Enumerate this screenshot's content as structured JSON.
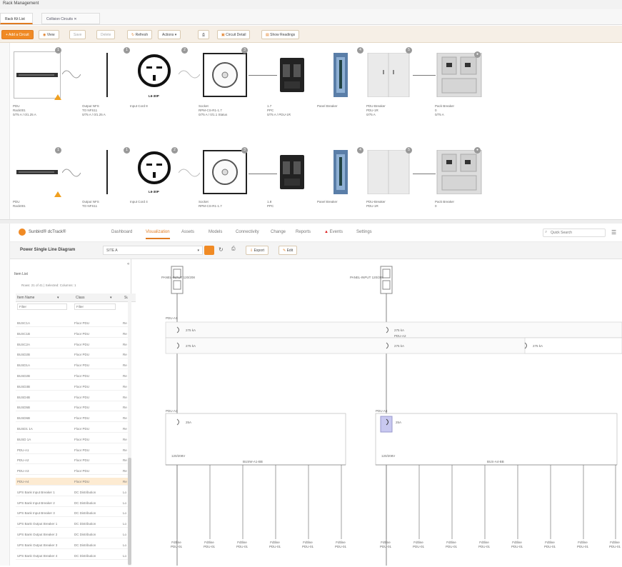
{
  "window": {
    "title": "Rack Management"
  },
  "tabs": [
    {
      "label": "Rack Kit List",
      "active": true
    },
    {
      "label": "Collision Circuits",
      "active": false
    }
  ],
  "toolbar": {
    "add_circuit": "Add a Circuit",
    "view": "View",
    "save": "Save",
    "delete": "Delete",
    "refresh": "Refresh",
    "actions": "Actions",
    "print": "",
    "circuit_detail": "Circuit Detail",
    "show_readings": "Show Readings"
  },
  "chain1": {
    "devices": [
      {
        "name": "PDU",
        "lines": [
          "PDU",
          "Rack001",
          "0/75 A / 0/1.25 A"
        ],
        "badge": "1"
      },
      {
        "name": "Output Cable",
        "lines": [
          "Output NFS",
          "TO NFS11",
          "0/75 A / 0/1.25 A"
        ],
        "badge": "1"
      },
      {
        "name": "Input Cord",
        "lines": [
          "Input Cord 8"
        ],
        "badge": "2",
        "plug": "L6-30P"
      },
      {
        "name": "Receptacle",
        "lines": [
          "Socket",
          "RPM-CS-R1-1.7",
          "0/75 A / 0/1.1 Status"
        ],
        "badge": "3"
      },
      {
        "name": "Breaker",
        "lines": [
          "1.7",
          "PPC",
          "0/75 A / PDU-1R"
        ],
        "badge": ""
      },
      {
        "name": "Panel",
        "lines": [
          "Panel Breaker"
        ],
        "badge": ""
      },
      {
        "name": "PDU-cabinet",
        "lines": [
          "PDU-Breaker",
          "PDU-1R",
          "0/75 A"
        ],
        "badge": "4"
      },
      {
        "name": "Switchgear",
        "lines": [
          "Pack Breaker",
          "0",
          "0/75 A"
        ],
        "badge": "5"
      }
    ]
  },
  "chain2": {
    "devices": [
      {
        "name": "PDU",
        "lines": [
          "PDU",
          "Rack001"
        ],
        "badge": "1"
      },
      {
        "name": "Output Cable",
        "lines": [
          "Output NFS",
          "TO NFS11"
        ],
        "badge": "1"
      },
      {
        "name": "Input Cord",
        "lines": [
          "Input Cord 4"
        ],
        "badge": "2",
        "plug": "L6-30P"
      },
      {
        "name": "Receptacle",
        "lines": [
          "Socket",
          "RPM-CS-R1-1.7"
        ],
        "badge": "3"
      },
      {
        "name": "Breaker",
        "lines": [
          "1.8",
          "PPC"
        ],
        "badge": ""
      },
      {
        "name": "Panel",
        "lines": [
          "Panel Breaker"
        ],
        "badge": ""
      },
      {
        "name": "PDU-cabinet",
        "lines": [
          "PDU-Breaker",
          "PDU-1R"
        ],
        "badge": "4"
      },
      {
        "name": "Switchgear",
        "lines": [
          "Pack Breaker",
          "0"
        ],
        "badge": "5"
      }
    ]
  },
  "app": {
    "brand": "Sunbird® dcTrack®",
    "nav": [
      "Dashboard",
      "Visualization",
      "Assets",
      "Models",
      "Connectivity",
      "Change",
      "Reports",
      "Events",
      "Settings"
    ],
    "active_nav": "Visualization",
    "search_placeholder": "Quick Search"
  },
  "subbar": {
    "title": "Power Single Line Diagram",
    "location": "SITE A",
    "export": "Export",
    "edit": "Edit"
  },
  "item_list": {
    "title": "Item List",
    "summary": "Rows: 21 of 41   |   Selected: Columns: 1",
    "col_name": "Item Name",
    "col_class": "Class",
    "col_sub": "Sub",
    "filter": "Filter",
    "rows": [
      {
        "name": "BUSC1A",
        "cls": "Floor PDU",
        "sub": "Re"
      },
      {
        "name": "BUSC1B",
        "cls": "Floor PDU",
        "sub": "Re"
      },
      {
        "name": "BUSC2A",
        "cls": "Floor PDU",
        "sub": "Re"
      },
      {
        "name": "BUSD2B",
        "cls": "Floor PDU",
        "sub": "Re"
      },
      {
        "name": "BUSD1A",
        "cls": "Floor PDU",
        "sub": "Re"
      },
      {
        "name": "BUSD2B",
        "cls": "Floor PDU",
        "sub": "Re"
      },
      {
        "name": "BUSD3B",
        "cls": "Floor PDU",
        "sub": "Re"
      },
      {
        "name": "BUSD4B",
        "cls": "Floor PDU",
        "sub": "Re"
      },
      {
        "name": "BUSD5B",
        "cls": "Floor PDU",
        "sub": "Re"
      },
      {
        "name": "BUSD6B",
        "cls": "Floor PDU",
        "sub": "Re"
      },
      {
        "name": "BUSD1 1A",
        "cls": "Floor PDU",
        "sub": "Re"
      },
      {
        "name": "BUSD 1A",
        "cls": "Floor PDU",
        "sub": "Re"
      },
      {
        "name": "PDU-A1",
        "cls": "Floor PDU",
        "sub": "Re"
      },
      {
        "name": "PDU-A2",
        "cls": "Floor PDU",
        "sub": "Re"
      },
      {
        "name": "PDU-A3",
        "cls": "Floor PDU",
        "sub": "Re"
      },
      {
        "name": "PDU-A4",
        "cls": "Floor PDU",
        "sub": "Re",
        "selected": true
      },
      {
        "name": "UPS Bank Input Breaker 1",
        "cls": "DC Distribution",
        "sub": "Lo"
      },
      {
        "name": "UPS Bank Input Breaker 2",
        "cls": "DC Distribution",
        "sub": "Lo"
      },
      {
        "name": "UPS Bank Input Breaker 3",
        "cls": "DC Distribution",
        "sub": "Lo"
      },
      {
        "name": "UPS Bank Output Breaker 1",
        "cls": "DC Distribution",
        "sub": "Lo"
      },
      {
        "name": "UPS Bank Output Breaker 2",
        "cls": "DC Distribution",
        "sub": "Lo"
      },
      {
        "name": "UPS Bank Output Breaker 3",
        "cls": "DC Distribution",
        "sub": "Lo"
      },
      {
        "name": "UPS Bank Output Breaker 4",
        "cls": "DC Distribution",
        "sub": "Lo"
      }
    ]
  },
  "diagram": {
    "left_top_label": "PANEL-INPUT 120/208",
    "right_top_label": "PANEL-INPUT 120/208",
    "b1_label": "PDU-A1",
    "b2_label": "PDU-A2",
    "br_a": "275 kA",
    "br_b": "275 kA",
    "br_c": "275 kA",
    "br_d": "275 kA",
    "br_e": "275 kA",
    "left_panel": "PDU-A3",
    "right_panel": "PDU-A4",
    "left_panel_br": "25A",
    "right_panel_br": "25A",
    "left_bus": "120/208V",
    "right_bus": "120/208V",
    "left_bus_mid": "BUSW-A1-BB",
    "right_bus_mid": "BUS-A4-BB",
    "out_label": "Fdtline",
    "out_sub": "PDU-01"
  }
}
